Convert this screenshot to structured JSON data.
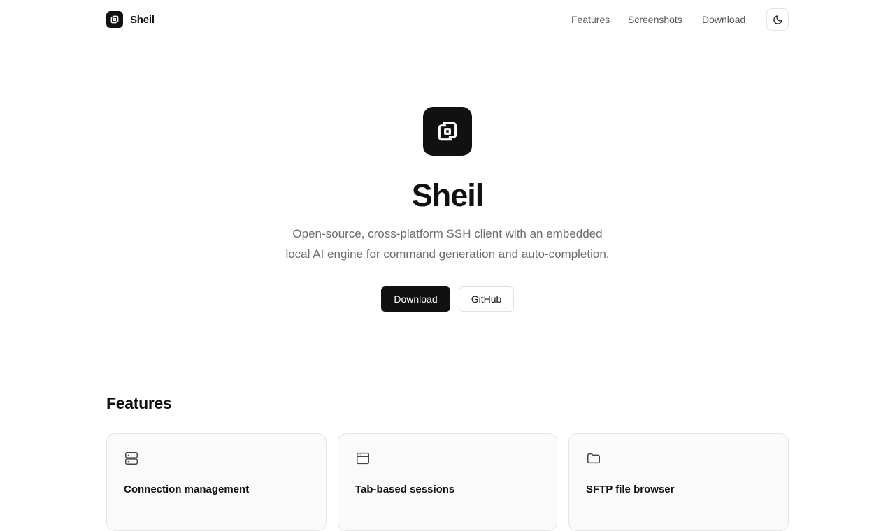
{
  "header": {
    "brand_name": "Sheil",
    "nav": [
      {
        "label": "Features"
      },
      {
        "label": "Screenshots"
      },
      {
        "label": "Download"
      }
    ],
    "theme_toggle_icon": "moon-icon"
  },
  "hero": {
    "logo_icon": "app-logo-icon",
    "title": "Sheil",
    "subtitle_line1": "Open-source, cross-platform SSH client with an embedded",
    "subtitle_line2": "local AI engine for command generation and auto-completion.",
    "primary_button": "Download",
    "secondary_button": "GitHub"
  },
  "features": {
    "title": "Features",
    "cards": [
      {
        "icon": "server-icon",
        "title": "Connection management"
      },
      {
        "icon": "browser-window-icon",
        "title": "Tab-based sessions"
      },
      {
        "icon": "folder-icon",
        "title": "SFTP file browser"
      }
    ]
  },
  "colors": {
    "primary": "#111111",
    "muted_text": "#6b6b6b",
    "border": "#e5e5e5",
    "card_bg": "#fafafa"
  }
}
